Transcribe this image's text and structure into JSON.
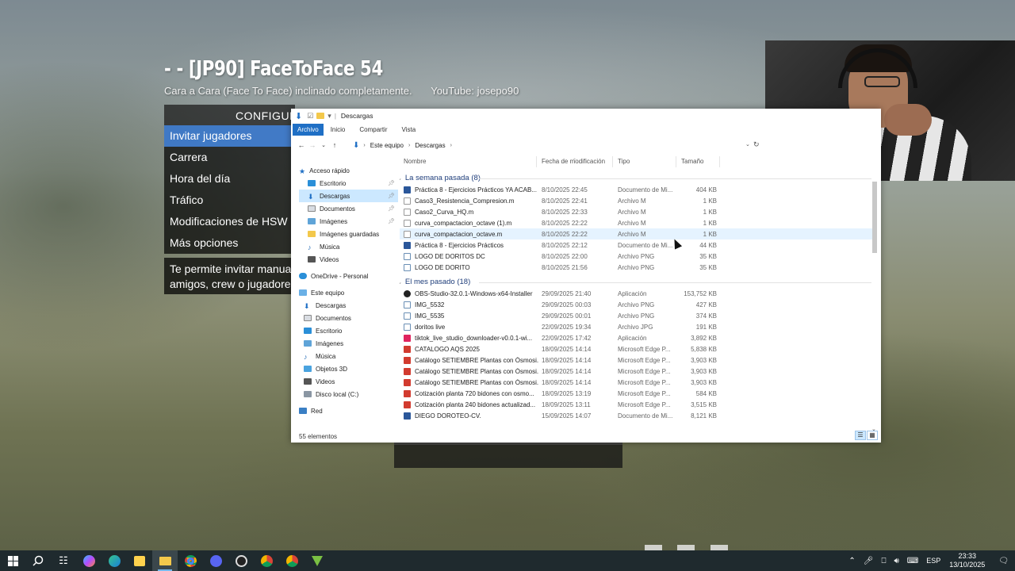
{
  "game": {
    "title": "- - [JP90] FaceToFace 54",
    "subtitle_left": "Cara a Cara (Face To Face) inclinado completamente.",
    "subtitle_right": "YouTube: josepo90",
    "menu_header": "CONFIGUR",
    "menu_items": [
      "Invitar jugadores",
      "Carrera",
      "Hora del día",
      "Tráfico",
      "Modificaciones de HSW",
      "Más opciones"
    ],
    "description_line1": "Te permite invitar manual",
    "description_line2": "amigos, crew o jugadores"
  },
  "explorer": {
    "window_title": "Descargas",
    "ribbon_tabs": [
      "Archivo",
      "Inicio",
      "Compartir",
      "Vista"
    ],
    "breadcrumb": [
      "Este equipo",
      "Descargas"
    ],
    "columns": {
      "name": "Nombre",
      "date": "Fecha de modificación",
      "type": "Tipo",
      "size": "Tamaño"
    },
    "nav": {
      "quick_access": "Acceso rápido",
      "quick_items": [
        "Escritorio",
        "Descargas",
        "Documentos",
        "Imágenes",
        "Imágenes guardadas",
        "Música",
        "Videos"
      ],
      "onedrive": "OneDrive - Personal",
      "this_pc": "Este equipo",
      "pc_items": [
        "Descargas",
        "Documentos",
        "Escritorio",
        "Imágenes",
        "Música",
        "Objetos 3D",
        "Videos",
        "Disco local (C:)"
      ],
      "network": "Red"
    },
    "groups": [
      {
        "label": "La semana pasada (8)",
        "files": [
          {
            "name": "Práctica 8 - Ejercicios Prácticos YA ACAB...",
            "date": "8/10/2025 22:45",
            "type": "Documento de Mi...",
            "size": "404 KB",
            "icon": "word-doc-icon"
          },
          {
            "name": "Caso3_Resistencia_Compresion.m",
            "date": "8/10/2025 22:41",
            "type": "Archivo M",
            "size": "1 KB",
            "icon": "blank-file-icon"
          },
          {
            "name": "Caso2_Curva_HQ.m",
            "date": "8/10/2025 22:33",
            "type": "Archivo M",
            "size": "1 KB",
            "icon": "blank-file-icon"
          },
          {
            "name": "curva_compactacion_octave (1).m",
            "date": "8/10/2025 22:22",
            "type": "Archivo M",
            "size": "1 KB",
            "icon": "blank-file-icon"
          },
          {
            "name": "curva_compactacion_octave.m",
            "date": "8/10/2025 22:22",
            "type": "Archivo M",
            "size": "1 KB",
            "icon": "blank-file-icon"
          },
          {
            "name": "Práctica 8 - Ejercicios Prácticos",
            "date": "8/10/2025 22:12",
            "type": "Documento de Mi...",
            "size": "44 KB",
            "icon": "word-doc-icon"
          },
          {
            "name": "LOGO DE DORITOS DC",
            "date": "8/10/2025 22:00",
            "type": "Archivo PNG",
            "size": "35 KB",
            "icon": "image-file-icon"
          },
          {
            "name": "LOGO DE DORITO",
            "date": "8/10/2025 21:56",
            "type": "Archivo PNG",
            "size": "35 KB",
            "icon": "image-file-icon"
          }
        ]
      },
      {
        "label": "El mes pasado (18)",
        "files": [
          {
            "name": "OBS-Studio-32.0.1-Windows-x64-Installer",
            "date": "29/09/2025 21:40",
            "type": "Aplicación",
            "size": "153,752 KB",
            "icon": "obs-icon"
          },
          {
            "name": "IMG_5532",
            "date": "29/09/2025 00:03",
            "type": "Archivo PNG",
            "size": "427 KB",
            "icon": "image-file-icon"
          },
          {
            "name": "IMG_5535",
            "date": "29/09/2025 00:01",
            "type": "Archivo PNG",
            "size": "374 KB",
            "icon": "image-file-icon"
          },
          {
            "name": "doritos live",
            "date": "22/09/2025 19:34",
            "type": "Archivo JPG",
            "size": "191 KB",
            "icon": "image-file-icon"
          },
          {
            "name": "tiktok_live_studio_downloader-v0.0.1-wi...",
            "date": "22/09/2025 17:42",
            "type": "Aplicación",
            "size": "3,892 KB",
            "icon": "tiktok-icon"
          },
          {
            "name": "CATALOGO AQS 2025",
            "date": "18/09/2025 14:14",
            "type": "Microsoft Edge P...",
            "size": "5,838 KB",
            "icon": "pdf-icon"
          },
          {
            "name": "Catálogo SETIEMBRE Plantas con Ósmosi...",
            "date": "18/09/2025 14:14",
            "type": "Microsoft Edge P...",
            "size": "3,903 KB",
            "icon": "pdf-icon"
          },
          {
            "name": "Catálogo SETIEMBRE Plantas con Ósmosi...",
            "date": "18/09/2025 14:14",
            "type": "Microsoft Edge P...",
            "size": "3,903 KB",
            "icon": "pdf-icon"
          },
          {
            "name": "Catálogo SETIEMBRE Plantas con Ósmosi...",
            "date": "18/09/2025 14:14",
            "type": "Microsoft Edge P...",
            "size": "3,903 KB",
            "icon": "pdf-icon"
          },
          {
            "name": "Cotización planta 720 bidones con osmo...",
            "date": "18/09/2025 13:19",
            "type": "Microsoft Edge P...",
            "size": "584 KB",
            "icon": "pdf-icon"
          },
          {
            "name": "Cotización planta 240 bidones actualizad...",
            "date": "18/09/2025 13:11",
            "type": "Microsoft Edge P...",
            "size": "3,515 KB",
            "icon": "pdf-icon"
          },
          {
            "name": "DIEGO DOROTEO-CV.",
            "date": "15/09/2025 14:07",
            "type": "Documento de Mi...",
            "size": "8,121 KB",
            "icon": "word-doc-icon"
          }
        ]
      }
    ],
    "status": "55 elementos"
  },
  "taskbar": {
    "icons": [
      "windows-start-icon",
      "search-icon",
      "task-view-icon",
      "copilot-icon",
      "edge-icon",
      "store-icon",
      "file-explorer-icon",
      "chrome-icon",
      "discord-icon",
      "obs-icon",
      "chrome-icon",
      "chrome-icon",
      "nvidia-icon"
    ],
    "language": "ESP",
    "time": "23:33",
    "date": "13/10/2025"
  },
  "colors": {
    "accent": "#1f6fc5",
    "menu_highlight": "#3c78c8",
    "selection": "#cce8ff",
    "group_header": "#1e3d7a"
  }
}
